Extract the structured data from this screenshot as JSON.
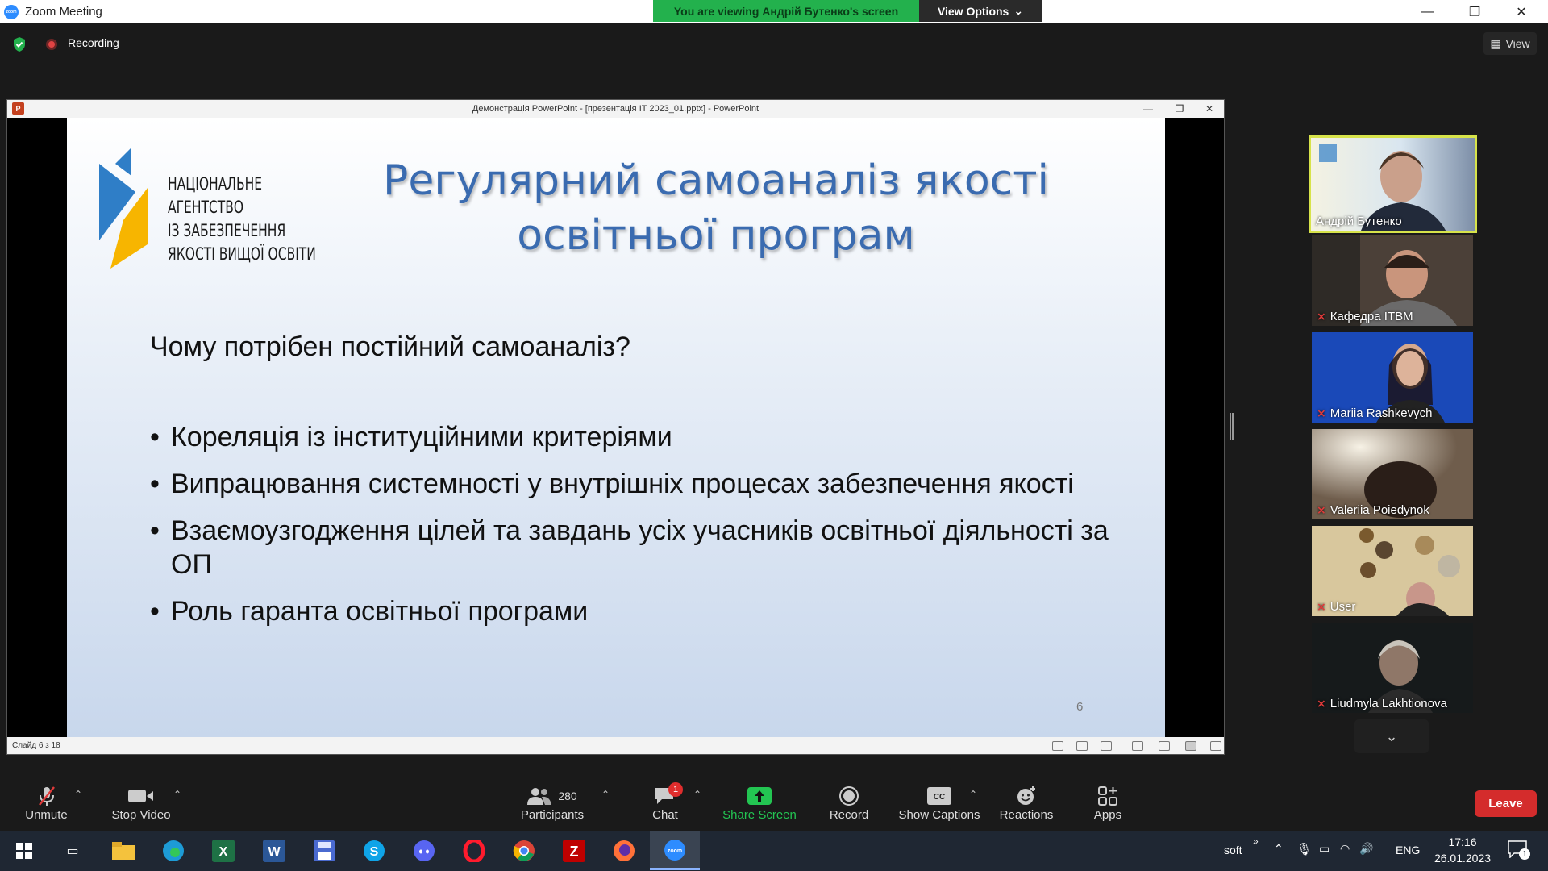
{
  "window": {
    "title": "Zoom Meeting",
    "viewing_banner": "You are viewing Андрій Бутенко's screen",
    "view_options": "View Options",
    "app_icon_text": "zoom"
  },
  "status": {
    "recording": "Recording",
    "view_button": "View"
  },
  "ppt": {
    "window_title": "Демонстрація PowerPoint - [презентація IT 2023_01.pptx] - PowerPoint",
    "status_left": "Слайд 6 з 18"
  },
  "slide": {
    "logo_lines": [
      "НАЦІОНАЛЬНЕ",
      "АГЕНТСТВО",
      "ІЗ ЗАБЕЗПЕЧЕННЯ",
      "ЯКОСТІ ВИЩОЇ ОСВІТИ"
    ],
    "title_line1": "Регулярний самоаналіз якості",
    "title_line2": "освітньої програм",
    "question": "Чому потрібен постійний самоаналіз?",
    "bullets": [
      "Кореляція із інституційними критеріями",
      "Випрацювання системності у внутрішніх процесах забезпечення якості",
      "Взаємоузгодження цілей та завдань усіх учасників освітньої діяльності за ОП",
      "Роль гаранта освітньої програми"
    ],
    "number": "6"
  },
  "participants_gallery": [
    {
      "name": "Андрій Бутенко",
      "muted": false,
      "active": true
    },
    {
      "name": "Кафедра ІТВМ",
      "muted": true
    },
    {
      "name": "Mariia Rashkevych",
      "muted": true
    },
    {
      "name": "Valeriia Poiedynok",
      "muted": true
    },
    {
      "name": "User",
      "muted": true
    },
    {
      "name": "Liudmyla  Lakhtionova",
      "muted": true
    }
  ],
  "toolbar": {
    "unmute": "Unmute",
    "stop_video": "Stop Video",
    "participants": "Participants",
    "participants_count": "280",
    "chat": "Chat",
    "chat_badge": "1",
    "share_screen": "Share Screen",
    "record": "Record",
    "show_captions": "Show Captions",
    "reactions": "Reactions",
    "apps": "Apps",
    "leave": "Leave"
  },
  "taskbar": {
    "tray_user": "soft",
    "language": "ENG",
    "time": "17:16",
    "date": "26.01.2023",
    "notification_count": "1"
  }
}
